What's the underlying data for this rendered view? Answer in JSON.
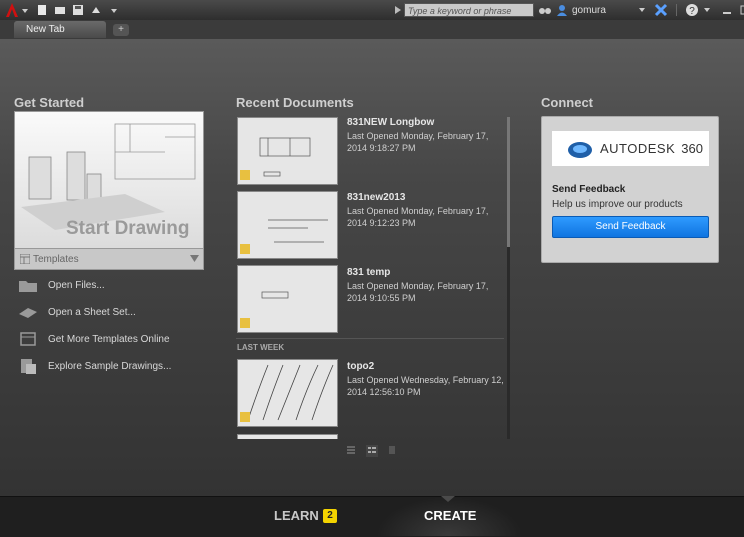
{
  "titlebar": {
    "search_placeholder": "Type a keyword or phrase",
    "username": "gomura"
  },
  "tabs": [
    {
      "label": "New Tab"
    },
    {
      "label": "+"
    }
  ],
  "get_started": {
    "title": "Get Started",
    "start_drawing": "Start Drawing",
    "templates": "Templates",
    "links": [
      {
        "label": "Open Files...",
        "icon": "folder-icon"
      },
      {
        "label": "Open a Sheet Set...",
        "icon": "sheet-set-icon"
      },
      {
        "label": "Get More Templates Online",
        "icon": "templates-online-icon"
      },
      {
        "label": "Explore Sample Drawings...",
        "icon": "sample-drawings-icon"
      }
    ]
  },
  "recent": {
    "title": "Recent Documents",
    "last_week_label": "LAST WEEK",
    "documents": [
      {
        "name": "831NEW Longbow",
        "meta": "Last Opened Monday, February 17, 2014 9:18:27 PM"
      },
      {
        "name": "831new2013",
        "meta": "Last Opened Monday, February 17, 2014 9:12:23 PM"
      },
      {
        "name": "831 temp",
        "meta": "Last Opened Monday, February 17, 2014 9:10:55 PM"
      },
      {
        "name": "topo2",
        "meta": "Last Opened Wednesday, February 12, 2014 12:56:10 PM"
      }
    ]
  },
  "connect": {
    "title": "Connect",
    "brand": "AUTODESK",
    "brand_suffix": "360",
    "feedback_title": "Send Feedback",
    "feedback_subtitle": "Help us improve our products",
    "feedback_button": "Send Feedback"
  },
  "bottom": {
    "learn": "LEARN",
    "learn_badge": "2",
    "create": "CREATE"
  },
  "colors": {
    "accent": "#1a86f0",
    "badge": "#f3d300",
    "app_red": "#d01010"
  }
}
